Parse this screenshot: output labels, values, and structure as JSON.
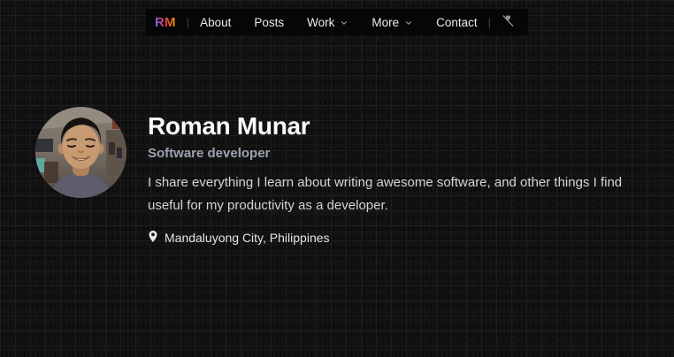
{
  "nav": {
    "logo": "RM",
    "divider": "|",
    "items": [
      {
        "label": "About",
        "has_dropdown": false
      },
      {
        "label": "Posts",
        "has_dropdown": false
      },
      {
        "label": "Work",
        "has_dropdown": true
      },
      {
        "label": "More",
        "has_dropdown": true
      },
      {
        "label": "Contact",
        "has_dropdown": false
      }
    ],
    "action_icon": "flashlight-off-icon"
  },
  "profile": {
    "name": "Roman Munar",
    "title": "Software developer",
    "bio": "I share everything I learn about writing awesome software, and other things I find useful for my productivity as a developer.",
    "location": "Mandaluyong City, Philippines",
    "location_icon": "map-pin-icon",
    "avatar": "portrait-photo-of-roman-munar"
  },
  "colors": {
    "page_background": "#121212",
    "grid_line": "#1e1e1e",
    "nav_background": "#060606",
    "nav_text": "#ececec",
    "logo_gradient": [
      "#7c5cfa",
      "#e8403a",
      "#f59e0b"
    ],
    "name_text": "#fafafa",
    "title_text": "#9ca3af",
    "bio_text": "#d4d4d4",
    "divider": "#3f3f46"
  }
}
